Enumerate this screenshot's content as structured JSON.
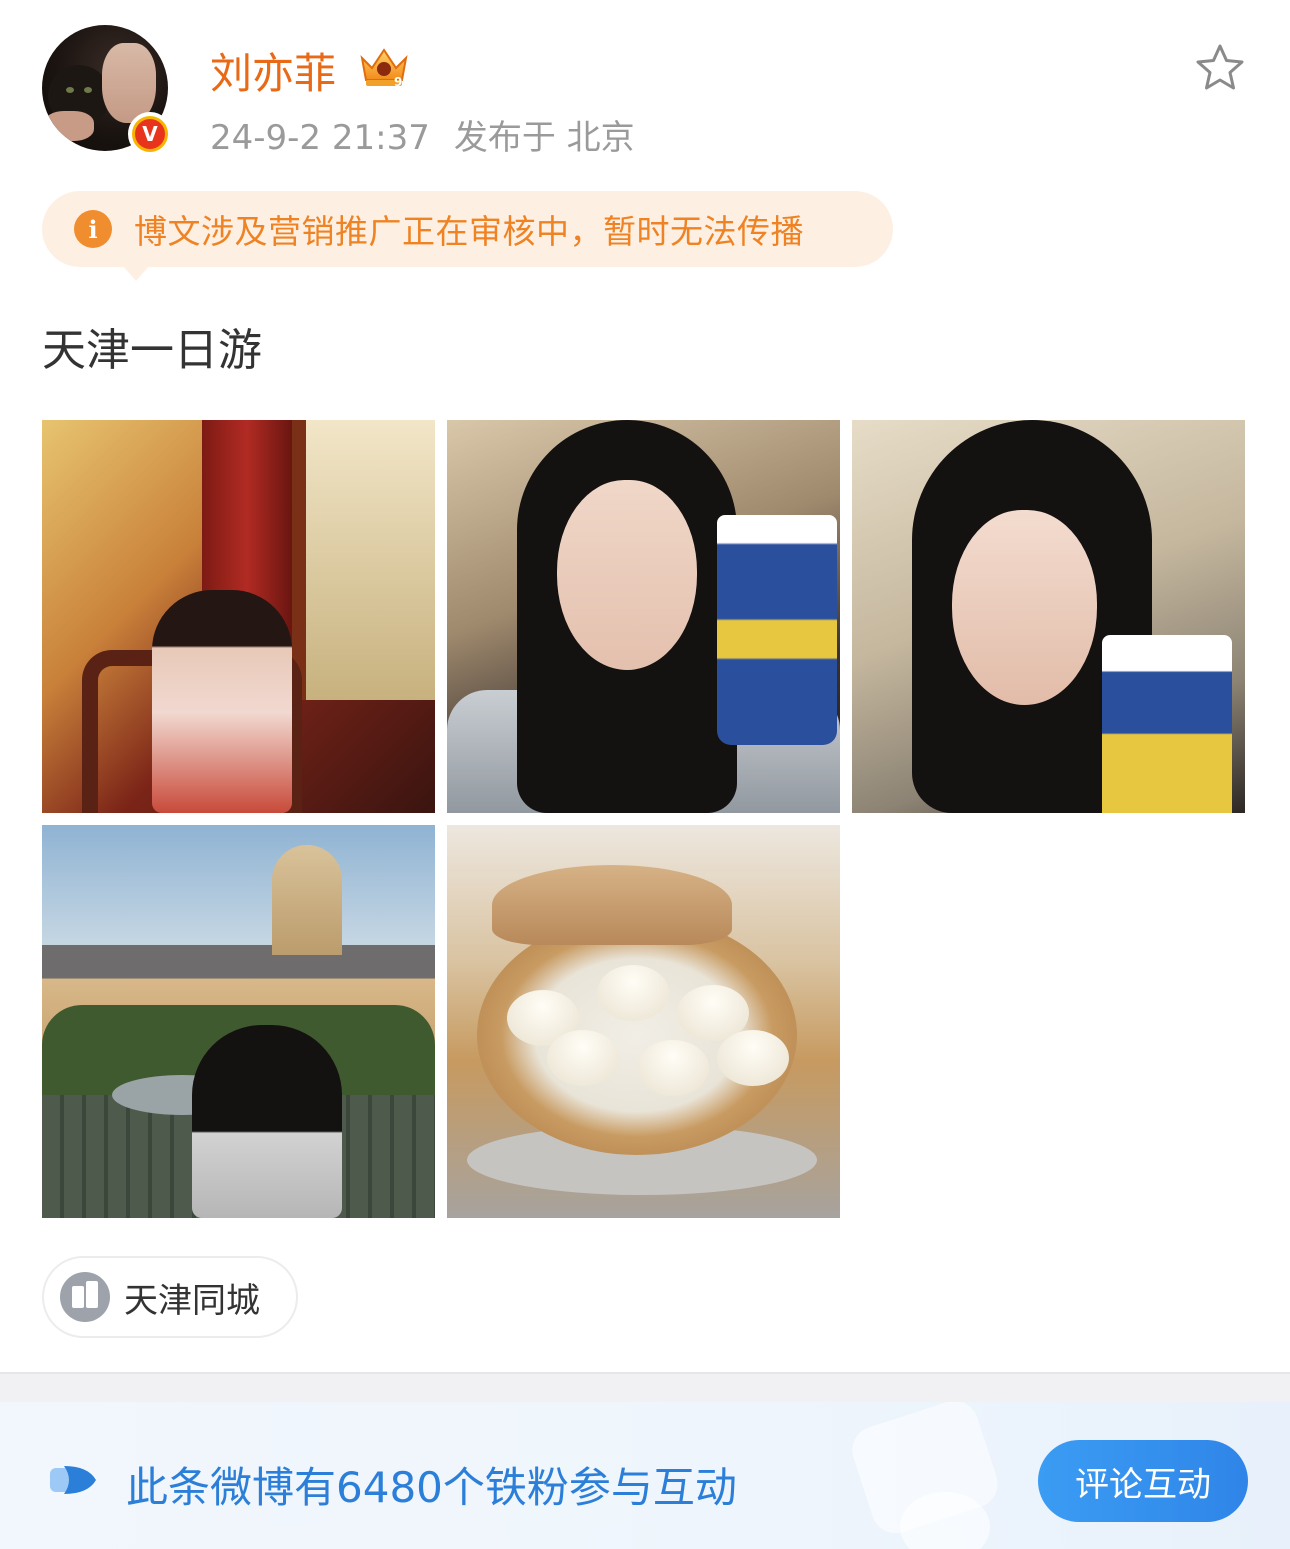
{
  "author": {
    "name": "刘亦菲",
    "verified_badge": "V",
    "crown_level": "9"
  },
  "post": {
    "date": "24-9-2 21:37",
    "location": "发布于 北京",
    "notice": "博文涉及营销推广正在审核中，暂时无法传播",
    "text": "天津一日游",
    "images": [
      "tianjin-photo-1",
      "tianjin-photo-2",
      "tianjin-photo-3",
      "tianjin-photo-4",
      "tianjin-photo-5"
    ],
    "location_tag": "天津同城"
  },
  "fan_bar": {
    "text": "此条微博有6480个铁粉参与互动",
    "button": "评论互动"
  },
  "icons": {
    "favorite": "star-outline-icon",
    "notice": "info-icon",
    "location": "city-building-icon",
    "fan": "double-arrow-icon",
    "crown": "crown-icon"
  },
  "colors": {
    "username": "#e86a17",
    "notice_bg": "#fdf0e3",
    "notice_text": "#ef8324",
    "fan_text": "#2c7fd8",
    "button": "#2f85e8"
  }
}
